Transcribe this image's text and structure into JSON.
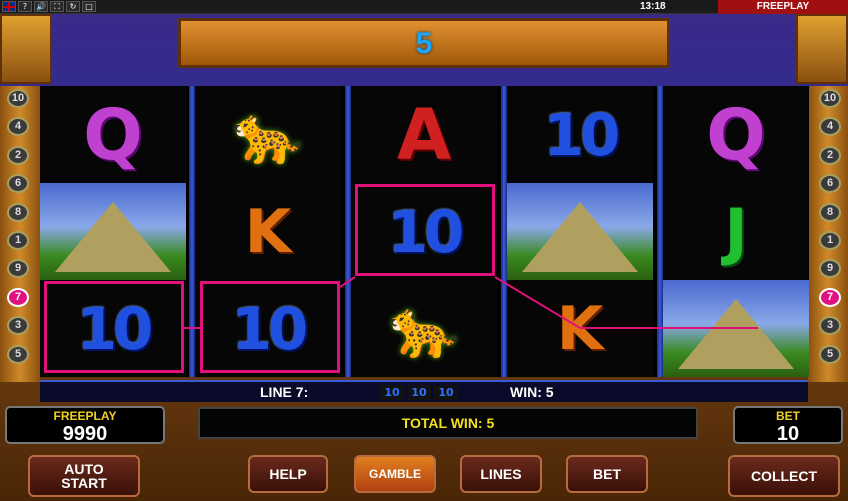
{
  "topbar": {
    "icons": [
      "uk-flag",
      "?",
      "🔊",
      "⛶",
      "↻",
      "□"
    ],
    "time": "13:18",
    "mode": "FREEPLAY"
  },
  "header": {
    "value": "5"
  },
  "line_buttons_left": [
    "10",
    "4",
    "2",
    "6",
    "8",
    "1",
    "9",
    "7",
    "3",
    "5"
  ],
  "line_buttons_right": [
    "10",
    "4",
    "2",
    "6",
    "8",
    "1",
    "9",
    "7",
    "3",
    "5"
  ],
  "active_line": "7",
  "reels": [
    [
      "Q",
      "temple",
      "10"
    ],
    [
      "jaguar",
      "K",
      "10"
    ],
    [
      "A",
      "10",
      "jaguar"
    ],
    [
      "10",
      "temple",
      "K"
    ],
    [
      "Q",
      "J",
      "temple"
    ]
  ],
  "info": {
    "line_label": "LINE 7:",
    "line_symbols": [
      "10",
      "10",
      "10"
    ],
    "win_label": "WIN: 5"
  },
  "balance": {
    "label": "FREEPLAY",
    "value": "9990"
  },
  "bet": {
    "label": "BET",
    "value": "10"
  },
  "total_win": "TOTAL WIN: 5",
  "buttons": {
    "auto_start_1": "AUTO",
    "auto_start_2": "START",
    "help": "HELP",
    "gamble": "GAMBLE",
    "lines": "LINES",
    "bet": "BET",
    "collect": "COLLECT"
  },
  "colors": {
    "payline": "#e0107a",
    "accent": "#1aa8ff"
  }
}
